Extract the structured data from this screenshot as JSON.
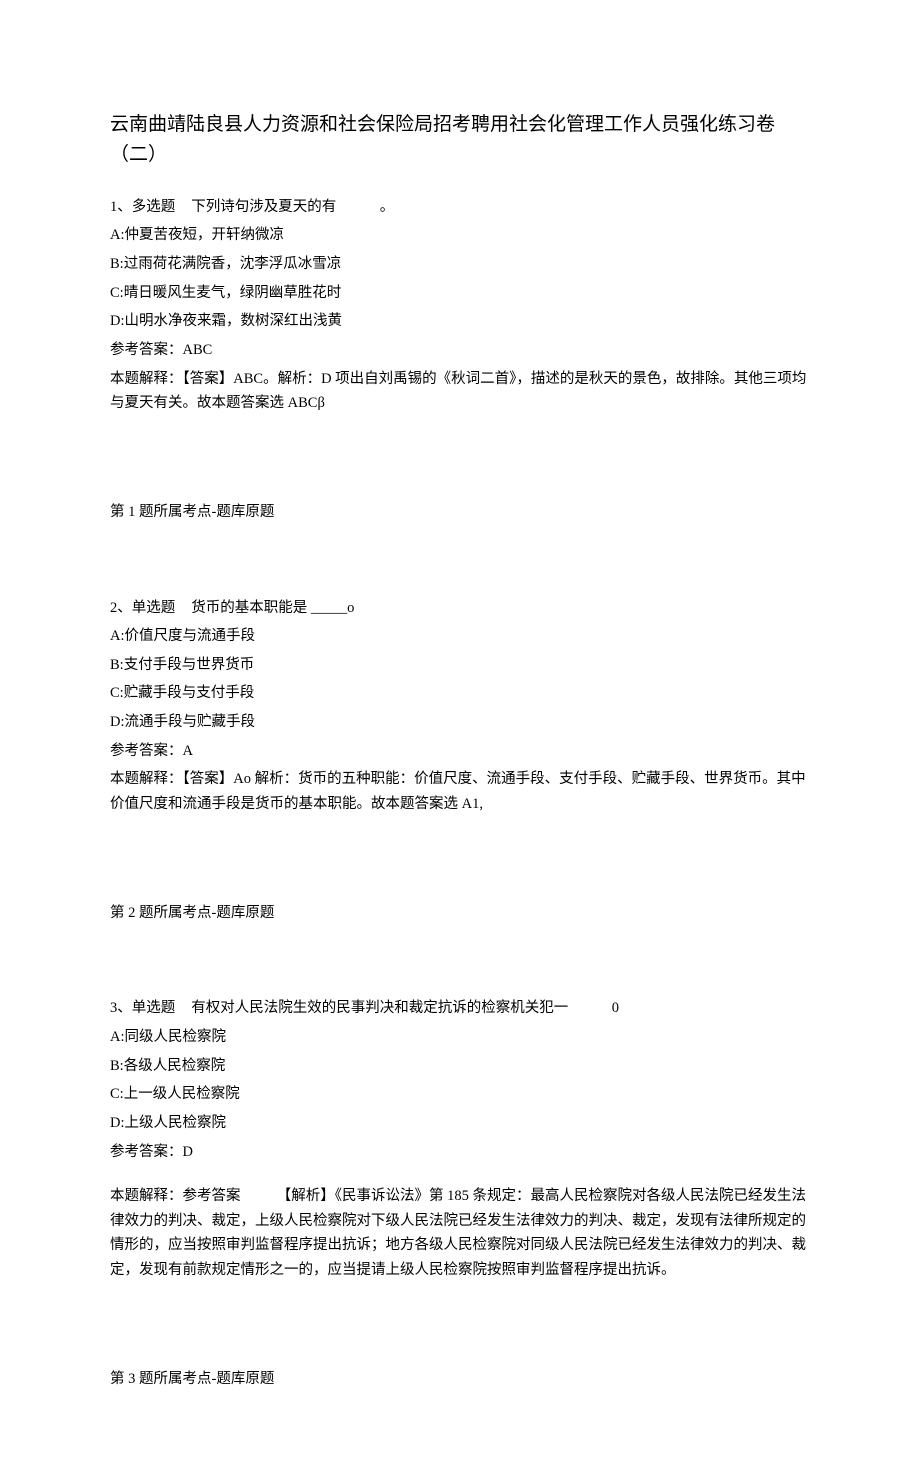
{
  "title": "云南曲靖陆良县人力资源和社会保险局招考聘用社会化管理工作人员强化练习卷（二）",
  "q1": {
    "num": "1、",
    "type": "多选题",
    "stem": "下列诗句涉及夏天的有　　　。",
    "optA": "A:仲夏苦夜短，开轩纳微凉",
    "optB": "B:过雨荷花满院香，沈李浮瓜冰雪凉",
    "optC": "C:晴日暖风生麦气，绿阴幽草胜花时",
    "optD": "D:山明水净夜来霜，数树深红出浅黄",
    "ansLabel": "参考答案：ABC",
    "explain": "本题解释：【答案】ABC。解析：D 项出自刘禹锡的《秋词二首》，描述的是秋天的景色，故排除。其他三项均与夏天有关。故本题答案选 ABCβ",
    "topic": "第 1 题所属考点-题库原题"
  },
  "q2": {
    "num": "2、",
    "type": "单选题",
    "stem": "货币的基本职能是 _____o",
    "optA": "A:价值尺度与流通手段",
    "optB": "B:支付手段与世界货币",
    "optC": "C:贮藏手段与支付手段",
    "optD": "D:流通手段与贮藏手段",
    "ansLabel": "参考答案：A",
    "explain": "本题解释：【答案】Ao 解析：货币的五种职能：价值尺度、流通手段、支付手段、贮藏手段、世界货币。其中价值尺度和流通手段是货币的基本职能。故本题答案选 A1,",
    "topic": "第 2 题所属考点-题库原题"
  },
  "q3": {
    "num": "3、",
    "type": "单选题",
    "stem": "有权对人民法院生效的民事判决和裁定抗诉的检察机关犯一　　　0",
    "optA": "A:同级人民检察院",
    "optB": "B:各级人民检察院",
    "optC": "C:上一级人民检察院",
    "optD": "D:上级人民检察院",
    "ansLabel": "参考答案：D",
    "explain": "本题解释：参考答案　　　【解析】《民事诉讼法》第 185 条规定：最高人民检察院对各级人民法院已经发生法律效力的判决、裁定，上级人民检察院对下级人民法院已经发生法律效力的判决、裁定，发现有法律所规定的情形的，应当按照审判监督程序提出抗诉；地方各级人民检察院对同级人民法院已经发生法律效力的判决、裁定，发现有前款规定情形之一的，应当提请上级人民检察院按照审判监督程序提出抗诉。",
    "topic": "第 3 题所属考点-题库原题"
  }
}
